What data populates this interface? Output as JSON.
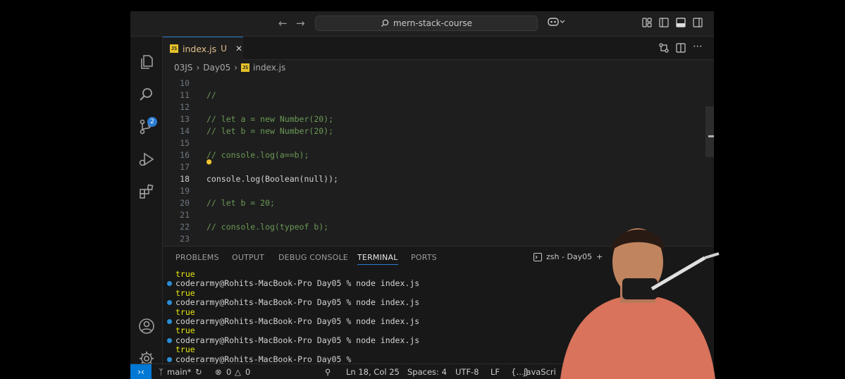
{
  "titlebar": {
    "search_text": "mern-stack-course",
    "back_icon": "arrow-left-icon",
    "forward_icon": "arrow-right-icon"
  },
  "activity_bar": {
    "items": [
      "explorer-icon",
      "search-icon",
      "source-control-icon",
      "run-debug-icon",
      "extensions-icon"
    ],
    "source_control_badge": "2",
    "bottom": [
      "account-icon",
      "settings-gear-icon"
    ]
  },
  "tab": {
    "label": "index.js",
    "status": "U",
    "icon": "JS"
  },
  "breadcrumb": {
    "items": [
      "03JS",
      "Day05",
      "index.js"
    ]
  },
  "editor": {
    "lines": [
      {
        "num": "10",
        "text": ""
      },
      {
        "num": "11",
        "text": "//"
      },
      {
        "num": "12",
        "text": ""
      },
      {
        "num": "13",
        "text": "// let a = new Number(20);"
      },
      {
        "num": "14",
        "text": "// let b = new Number(20);"
      },
      {
        "num": "15",
        "text": ""
      },
      {
        "num": "16",
        "text": "// console.log(a==b);"
      },
      {
        "num": "17",
        "text": ""
      },
      {
        "num": "18",
        "text": "console.log(Boolean(null));"
      },
      {
        "num": "19",
        "text": ""
      },
      {
        "num": "20",
        "text": "// let b = 20;"
      },
      {
        "num": "21",
        "text": ""
      },
      {
        "num": "22",
        "text": "// console.log(typeof b);"
      },
      {
        "num": "23",
        "text": ""
      }
    ],
    "active_line": "18"
  },
  "panel": {
    "tabs": [
      "PROBLEMS",
      "OUTPUT",
      "DEBUG CONSOLE",
      "TERMINAL",
      "PORTS"
    ],
    "active_tab": "TERMINAL",
    "terminal_name": "zsh - Day05",
    "terminal_lines": [
      {
        "text": "true",
        "type": "out"
      },
      {
        "text": "coderarmy@Rohits-MacBook-Pro Day05 % node index.js",
        "type": "cmd"
      },
      {
        "text": "true",
        "type": "out"
      },
      {
        "text": "coderarmy@Rohits-MacBook-Pro Day05 % node index.js",
        "type": "cmd"
      },
      {
        "text": "true",
        "type": "out"
      },
      {
        "text": "coderarmy@Rohits-MacBook-Pro Day05 % node index.js",
        "type": "cmd"
      },
      {
        "text": "true",
        "type": "out"
      },
      {
        "text": "coderarmy@Rohits-MacBook-Pro Day05 % node index.js",
        "type": "cmd"
      },
      {
        "text": "true",
        "type": "out"
      },
      {
        "text": "coderarmy@Rohits-MacBook-Pro Day05 % ",
        "type": "prompt"
      }
    ]
  },
  "statusbar": {
    "branch": "main*",
    "errors": "0",
    "warnings": "0",
    "cursor": "Ln 18, Col 25",
    "spaces": "Spaces: 4",
    "encoding": "UTF-8",
    "eol": "LF",
    "language": "JavaScri"
  }
}
